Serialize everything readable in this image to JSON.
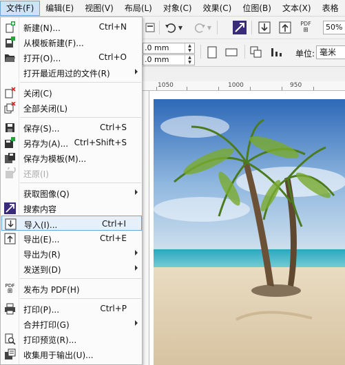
{
  "menubar": {
    "items": [
      "文件(F)",
      "编辑(E)",
      "视图(V)",
      "布局(L)",
      "对象(C)",
      "效果(C)",
      "位图(B)",
      "文本(X)",
      "表格"
    ]
  },
  "toolbar": {
    "pdf_label": "PDF",
    "zoom_value": "50%"
  },
  "propbar": {
    "width_value": ".0 mm",
    "height_value": ".0 mm",
    "unit_label": "单位:",
    "unit_value": "毫米"
  },
  "ruler": {
    "labels": [
      "1050",
      "1000",
      "950"
    ]
  },
  "file_menu": {
    "items": [
      {
        "label": "新建(N)...",
        "shortcut": "Ctrl+N",
        "icon": "new-document-icon"
      },
      {
        "label": "从模板新建(F)...",
        "shortcut": "",
        "icon": "new-from-template-icon"
      },
      {
        "label": "打开(O)...",
        "shortcut": "Ctrl+O",
        "icon": "open-folder-icon"
      },
      {
        "label": "打开最近用过的文件(R)",
        "shortcut": "",
        "icon": "",
        "submenu": true
      },
      {
        "label": "关闭(C)",
        "shortcut": "",
        "icon": "close-document-icon"
      },
      {
        "label": "全部关闭(L)",
        "shortcut": "",
        "icon": "close-all-icon"
      },
      {
        "label": "保存(S)...",
        "shortcut": "Ctrl+S",
        "icon": "save-icon"
      },
      {
        "label": "另存为(A)...",
        "shortcut": "Ctrl+Shift+S",
        "icon": "save-as-icon"
      },
      {
        "label": "保存为模板(M)...",
        "shortcut": "",
        "icon": "save-as-template-icon"
      },
      {
        "label": "还原(I)",
        "shortcut": "",
        "icon": "revert-icon",
        "disabled": true
      },
      {
        "label": "获取图像(Q)",
        "shortcut": "",
        "icon": "",
        "submenu": true
      },
      {
        "label": "搜索内容",
        "shortcut": "",
        "icon": "search-content-icon"
      },
      {
        "label": "导入(I)...",
        "shortcut": "Ctrl+I",
        "icon": "import-icon",
        "highlighted": true
      },
      {
        "label": "导出(E)...",
        "shortcut": "Ctrl+E",
        "icon": "export-icon"
      },
      {
        "label": "导出为(R)",
        "shortcut": "",
        "icon": "",
        "submenu": true
      },
      {
        "label": "发送到(D)",
        "shortcut": "",
        "icon": "",
        "submenu": true
      },
      {
        "label": "发布为 PDF(H)",
        "shortcut": "",
        "icon": "publish-pdf-icon"
      },
      {
        "label": "打印(P)...",
        "shortcut": "Ctrl+P",
        "icon": "print-icon"
      },
      {
        "label": "合并打印(G)",
        "shortcut": "",
        "icon": "",
        "submenu": true
      },
      {
        "label": "打印预览(R)...",
        "shortcut": "",
        "icon": "print-preview-icon"
      },
      {
        "label": "收集用于输出(U)...",
        "shortcut": "",
        "icon": "collect-for-output-icon"
      }
    ]
  },
  "colors": {
    "accent": "#6aa4dc",
    "highlight_bg": "#e6f0fa"
  }
}
